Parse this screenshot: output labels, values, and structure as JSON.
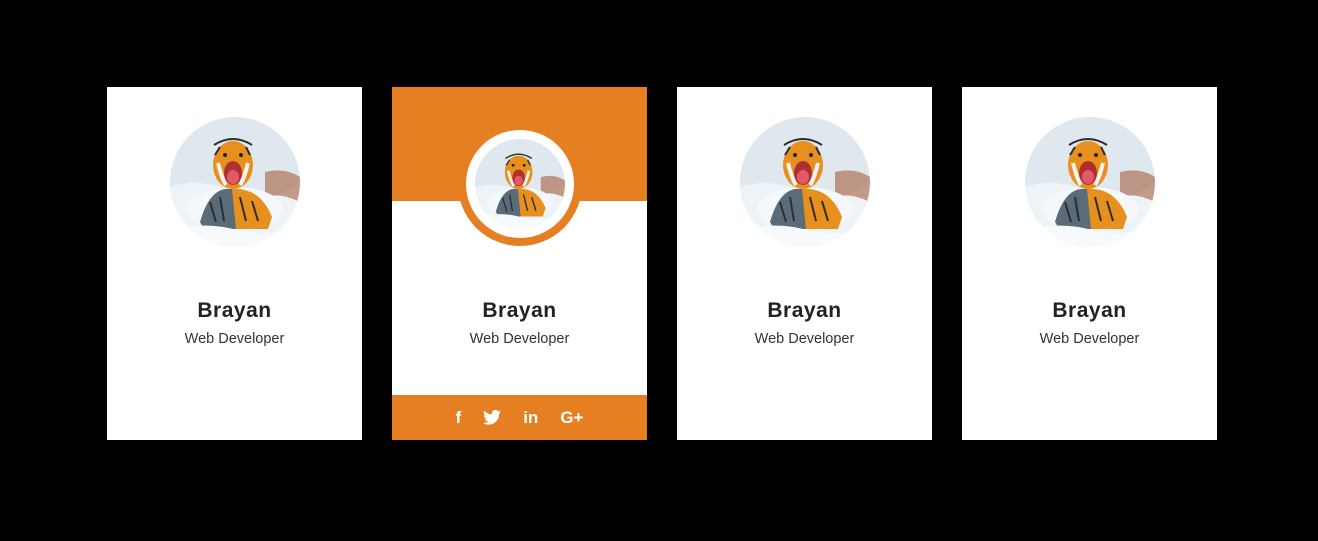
{
  "cards": [
    {
      "name": "Brayan",
      "role": "Web Developer"
    },
    {
      "name": "Brayan",
      "role": "Web Developer",
      "social": {
        "facebook": "f",
        "linkedin": "in",
        "googleplus": "G+"
      }
    },
    {
      "name": "Brayan",
      "role": "Web Developer"
    },
    {
      "name": "Brayan",
      "role": "Web Developer"
    }
  ],
  "colors": {
    "accent": "#e67e22",
    "background": "#000000",
    "card": "#ffffff"
  },
  "icons": [
    "facebook-icon",
    "twitter-icon",
    "linkedin-icon",
    "google-plus-icon"
  ]
}
